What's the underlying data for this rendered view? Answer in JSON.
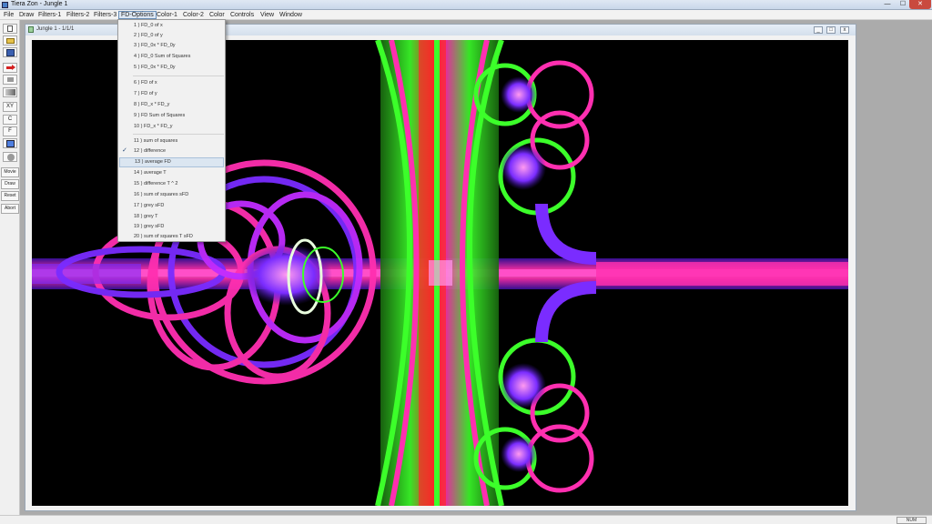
{
  "window": {
    "title": "Tiera Zon - Jungle 1",
    "min_glyph": "—",
    "max_glyph": "☐",
    "close_glyph": "✕"
  },
  "menubar": [
    {
      "label": "File"
    },
    {
      "label": "Draw"
    },
    {
      "label": "Filters-1"
    },
    {
      "label": "Filters-2"
    },
    {
      "label": "Filters-3"
    },
    {
      "label": "FD-Options"
    },
    {
      "label": "Color-1"
    },
    {
      "label": "Color-2"
    },
    {
      "label": "Color"
    },
    {
      "label": "Controls"
    },
    {
      "label": "View"
    },
    {
      "label": "Window"
    }
  ],
  "toolbar": {
    "new_icon": "new-file-icon",
    "open_icon": "open-folder-icon",
    "save_icon": "save-disk-icon",
    "red_arrow_icon": "red-arrow-icon",
    "grey_icon": "grey-tool-icon",
    "gradient_icon": "gradient-icon",
    "xy_label": "XY",
    "c_label": "C",
    "f_label": "F",
    "palette_icon": "palette-icon",
    "circle_icon": "circle-icon",
    "movie_label": "Movie",
    "draw_label": "Draw",
    "reset_label": "Reset",
    "abort_label": "Abort"
  },
  "child_window": {
    "title": "Jungle 1 - 1/1/1",
    "min_glyph": "_",
    "max_glyph": "□",
    "close_glyph": "x"
  },
  "fd_options": {
    "items": [
      {
        "label": "1 ) FD_0 of x",
        "checked": false
      },
      {
        "label": "2 ) FD_0 of y",
        "checked": false
      },
      {
        "label": "3 ) FD_0x * FD_0y",
        "checked": false
      },
      {
        "label": "4 ) FD_0 Sum of Squares",
        "checked": false
      },
      {
        "label": "5 ) FD_0x * FD_0y",
        "checked": false
      },
      {
        "label": "6 ) FD of x",
        "checked": false
      },
      {
        "label": "7 ) FD of y",
        "checked": false
      },
      {
        "label": "8 ) FD_x * FD_y",
        "checked": false
      },
      {
        "label": "9 ) FD Sum of Squares",
        "checked": false
      },
      {
        "label": "10 ) FD_x * FD_y",
        "checked": false
      },
      {
        "label": "11 ) sum of squares",
        "checked": false
      },
      {
        "label": "12 ) difference",
        "checked": true
      },
      {
        "label": "13 ) average FD",
        "checked": false
      },
      {
        "label": "14 ) average T",
        "checked": false
      },
      {
        "label": "15 ) difference T ^ 2",
        "checked": false
      },
      {
        "label": "16 ) sum of squares sFD",
        "checked": false
      },
      {
        "label": "17 ) grey sFD",
        "checked": false
      },
      {
        "label": "18 ) grey T",
        "checked": false
      },
      {
        "label": "19 ) grey sFD",
        "checked": false
      },
      {
        "label": "20 ) sum of squares T sFD",
        "checked": false
      }
    ],
    "check_glyph": "✓",
    "highlighted_index": 12
  },
  "statusbar": {
    "panel_text": "NUM"
  },
  "colors": {
    "fractal_magenta": "#ff2fb0",
    "fractal_purple": "#7a2cff",
    "fractal_green": "#3cff2a",
    "fractal_red": "#ff2a2a",
    "background": "#000000"
  }
}
